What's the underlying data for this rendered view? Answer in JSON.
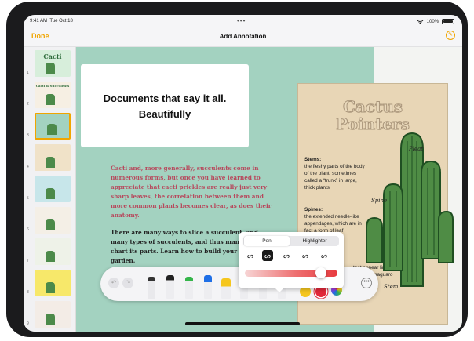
{
  "status_bar": {
    "time": "9:41 AM",
    "date": "Tue Oct 18",
    "battery": "100%"
  },
  "nav": {
    "done_label": "Done",
    "title": "Add Annotation"
  },
  "thumbnails": [
    {
      "number": "1",
      "title": "Cacti",
      "bg": "#d7eedb"
    },
    {
      "number": "2",
      "title": "Cacti & Succulents",
      "bg": "#f6efe3"
    },
    {
      "number": "3",
      "title": "",
      "bg": "#a3d2c0",
      "selected": true
    },
    {
      "number": "4",
      "title": "",
      "bg": "#f0e2c8"
    },
    {
      "number": "5",
      "title": "",
      "bg": "#c7e6ea"
    },
    {
      "number": "6",
      "title": "",
      "bg": "#f4efe6"
    },
    {
      "number": "7",
      "title": "",
      "bg": "#eef2e8"
    },
    {
      "number": "8",
      "title": "",
      "bg": "#f7e86a"
    },
    {
      "number": "9",
      "title": "",
      "bg": "#f3ece6"
    }
  ],
  "annotation": {
    "line1": "Documents that say it all.",
    "line2": "Beautifully"
  },
  "document": {
    "intro": "Cacti and, more generally, succulents come in numerous forms, but once you have learned to appreciate that cacti prickles are really just very sharp leaves, the correlation between them and more common plants becomes clear, as does their anatomy.",
    "paragraph2": "There are many ways to slice a succulent, and many types of succulents, and thus many ways to chart its parts. Learn how to build your dry garden."
  },
  "poster": {
    "title_line1": "Cactus",
    "title_line2": "Pointers",
    "stems_heading": "Stems:",
    "stems_text": "the fleshy parts of the body of the plant, sometimes called a “trunk” in large, thick plants",
    "spines_heading": "Spines:",
    "spines_text": "the extended needle-like appendages, which are in fact a form of leaf",
    "flowers_text": "that appear lin of large cacti, the saguaro",
    "handwriting": {
      "pleat": "Pleat",
      "spine": "Spine",
      "stem": "Stem"
    }
  },
  "toolbar": {
    "colors": [
      "#111111",
      "#1f6fe6",
      "#35b54a",
      "#f5c61d",
      "#e2283a"
    ],
    "selected_color": "#e2283a"
  },
  "pen_popup": {
    "tabs": [
      "Pen",
      "Highlighter"
    ],
    "selected_tab": "Pen",
    "stroke_glyphs": [
      "ᔕ",
      "ᔕ",
      "ᔕ",
      "ᔕ",
      "ᔕ"
    ],
    "opacity": 0.82
  }
}
